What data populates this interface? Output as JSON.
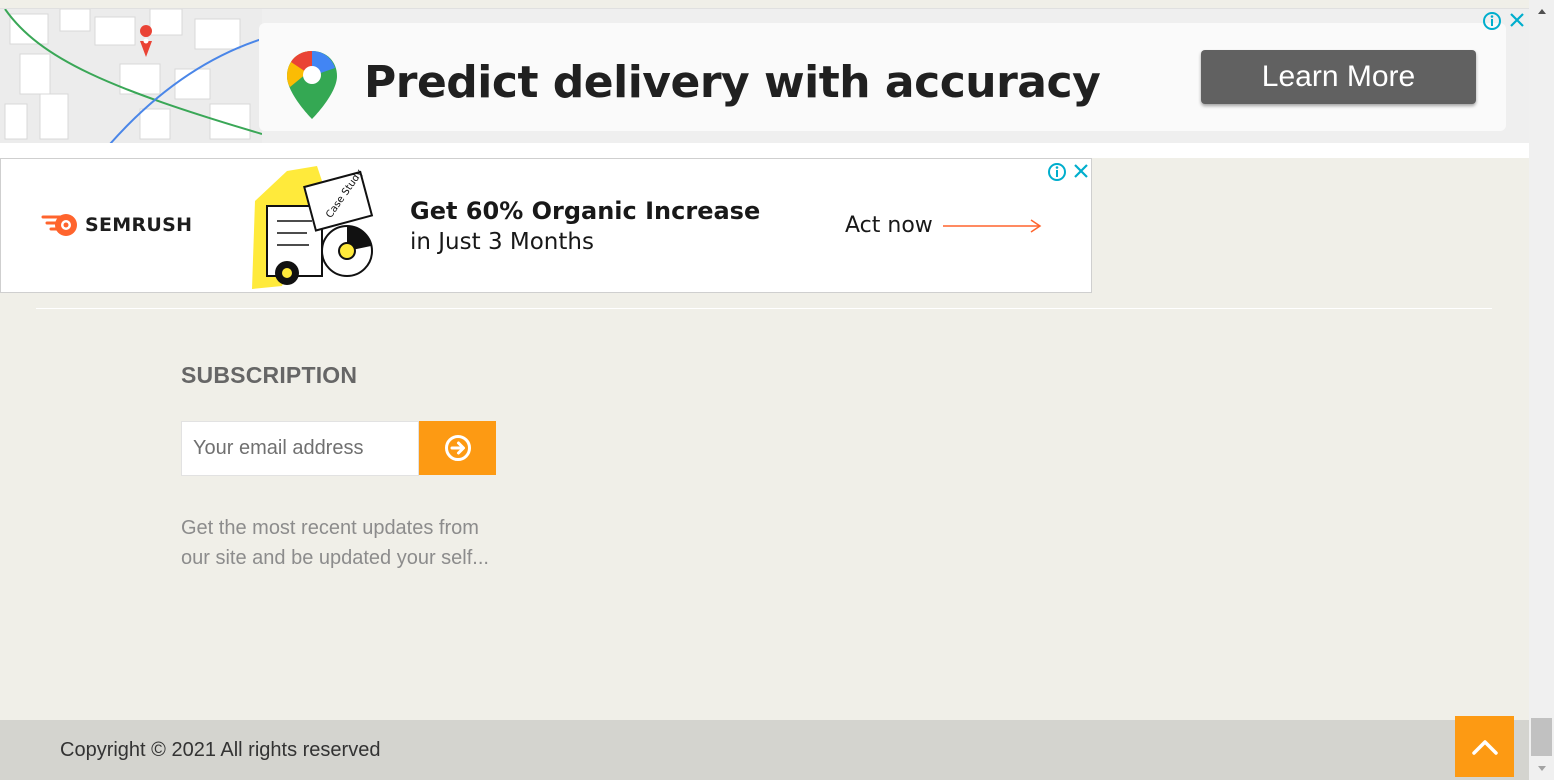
{
  "ad_top": {
    "headline": "Predict delivery with accuracy",
    "button_label": "Learn More"
  },
  "ad_semrush": {
    "brand": "SEMRUSH",
    "illustration_label": "Case Study",
    "line1": "Get 60% Organic Increase",
    "line2": "in Just 3 Months",
    "cta": "Act now"
  },
  "subscription": {
    "heading": "SUBSCRIPTION",
    "email_placeholder": "Your email address",
    "description": "Get the most recent updates from our site and be updated your self..."
  },
  "footer": {
    "copyright": "Copyright © 2021 All rights reserved"
  },
  "colors": {
    "accent": "#fd9a13",
    "page_bg": "#f0efe8",
    "footer_bg": "#d4d4cf",
    "adchoices_blue": "#00aecd"
  },
  "icons": {
    "ad_info": "info-icon",
    "ad_close": "close-icon",
    "submit": "arrow-circle-right-icon",
    "back_to_top": "chevron-up-icon"
  }
}
